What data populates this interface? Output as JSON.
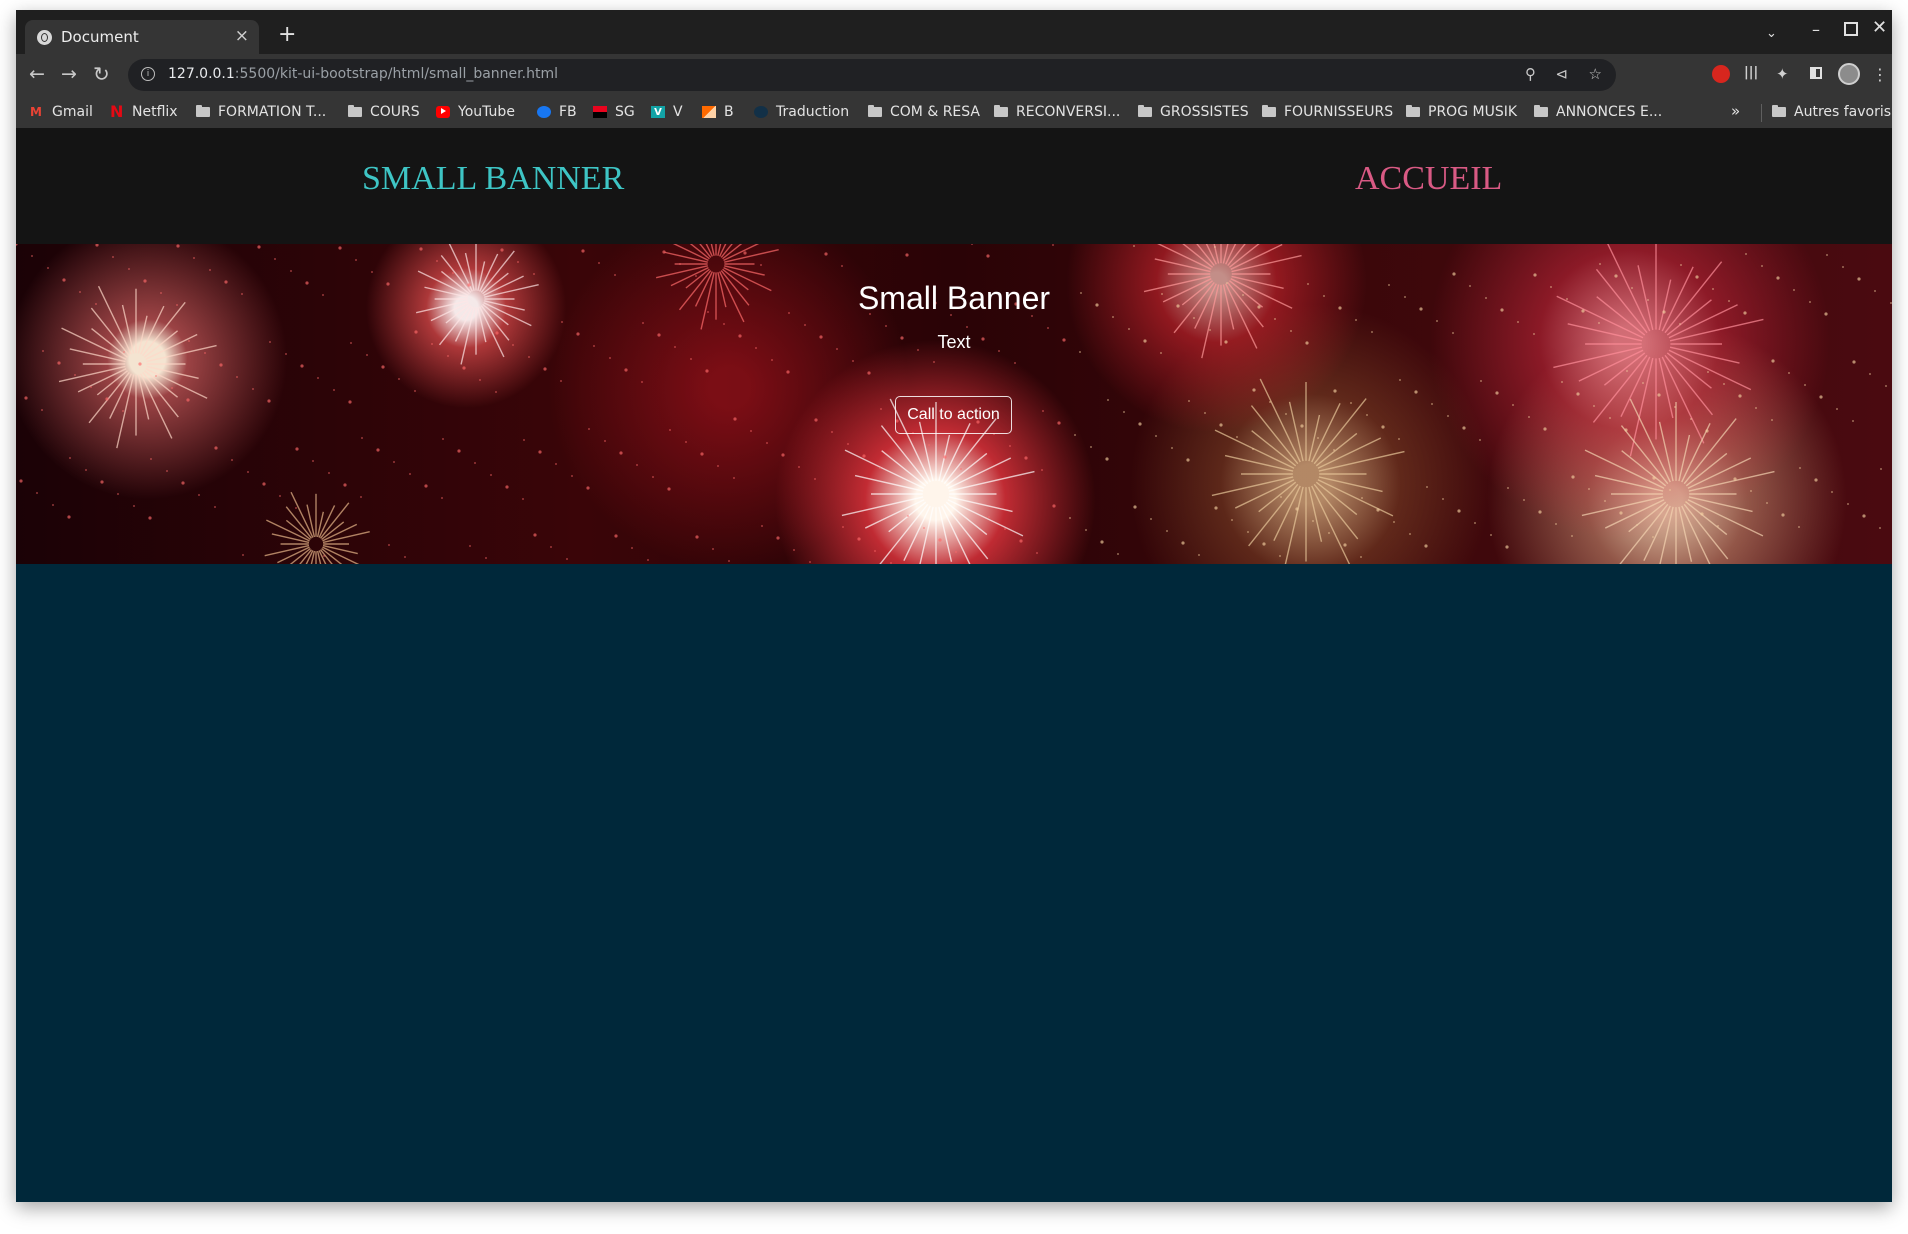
{
  "browser": {
    "tab_title": "Document",
    "tab_close": "×",
    "new_tab": "+",
    "url_host": "127.0.0.1",
    "url_rest": ":5500/kit-ui-bootstrap/html/small_banner.html",
    "info_glyph": "i"
  },
  "bookmarks": [
    {
      "label": "Gmail",
      "icon": "gmail-icon"
    },
    {
      "label": "Netflix",
      "icon": "netflix-icon"
    },
    {
      "label": "FORMATION T...",
      "icon": "folder-icon"
    },
    {
      "label": "COURS",
      "icon": "folder-icon"
    },
    {
      "label": "YouTube",
      "icon": "youtube-icon"
    },
    {
      "label": "FB",
      "icon": "facebook-icon"
    },
    {
      "label": "SG",
      "icon": "sg-icon"
    },
    {
      "label": "V",
      "icon": "v-icon"
    },
    {
      "label": "B",
      "icon": "b-icon"
    },
    {
      "label": "Traduction",
      "icon": "globe-icon"
    },
    {
      "label": "COM & RESA",
      "icon": "folder-icon"
    },
    {
      "label": "RECONVERSI...",
      "icon": "folder-icon"
    },
    {
      "label": "GROSSISTES",
      "icon": "folder-icon"
    },
    {
      "label": "FOURNISSEURS",
      "icon": "folder-icon"
    },
    {
      "label": "PROG MUSIK",
      "icon": "folder-icon"
    },
    {
      "label": "ANNONCES E...",
      "icon": "folder-icon"
    }
  ],
  "bookmarks_more": "»",
  "other_bookmarks": "Autres favoris",
  "site": {
    "brand": "SMALL BANNER",
    "nav_home": "ACCUEIL",
    "brand_color": "#3ec5c5",
    "nav_color": "#d95a84"
  },
  "banner": {
    "title": "Small Banner",
    "text": "Text",
    "cta": "Call to action"
  }
}
